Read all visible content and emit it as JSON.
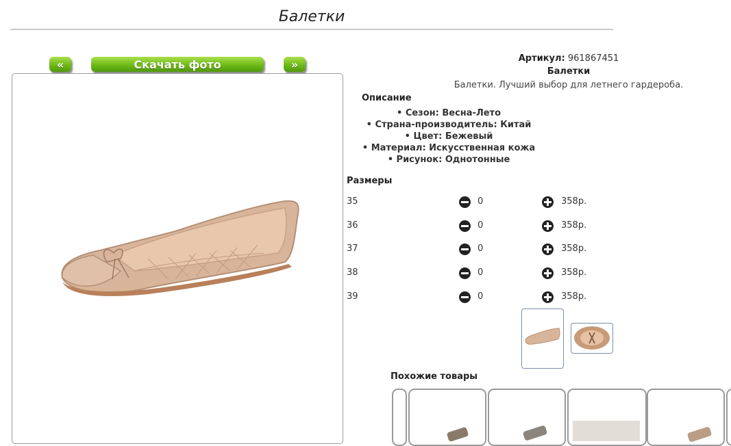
{
  "page": {
    "title": "Балетки"
  },
  "gallery": {
    "prev_label": "«",
    "download_label": "Скачать фото",
    "next_label": "»"
  },
  "product": {
    "article_label": "Артикул:",
    "article_value": "961867451",
    "name": "Балетки",
    "short_description": "Балетки. Лучший выбор для летнего гардероба.",
    "description_label": "Описание",
    "features": [
      "Сезон: Весна-Лето",
      "Страна-производитель: Китай",
      "Цвет: Бежевый",
      "Материал: Искусственная кожа",
      "Рисунок: Однотонные"
    ]
  },
  "sizes": {
    "label": "Размеры",
    "rows": [
      {
        "size": "35",
        "qty": "0",
        "price": "358р."
      },
      {
        "size": "36",
        "qty": "0",
        "price": "358р."
      },
      {
        "size": "37",
        "qty": "0",
        "price": "358р."
      },
      {
        "size": "38",
        "qty": "0",
        "price": "358р."
      },
      {
        "size": "39",
        "qty": "0",
        "price": "358р."
      }
    ]
  },
  "similar": {
    "label": "Похожие товары"
  },
  "colors": {
    "button_green": "#6fba17",
    "product_beige": "#d9b79e",
    "thumb_border": "#7a8eaa"
  }
}
